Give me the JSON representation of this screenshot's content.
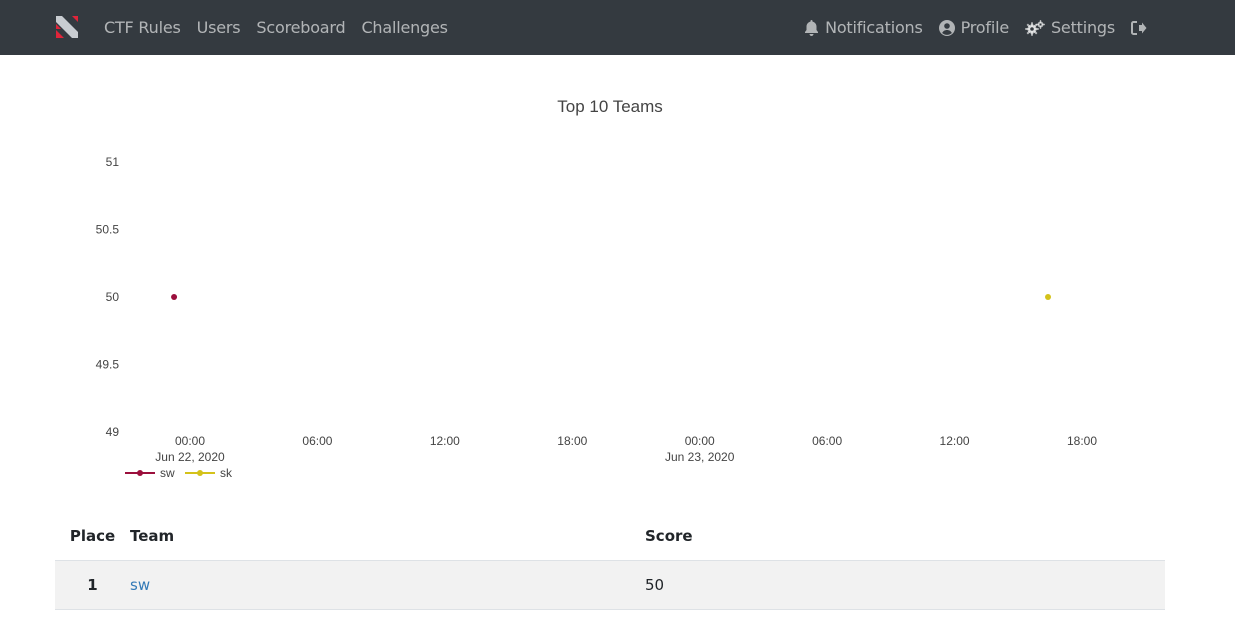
{
  "nav": {
    "left": [
      {
        "label": "CTF Rules"
      },
      {
        "label": "Users"
      },
      {
        "label": "Scoreboard"
      },
      {
        "label": "Challenges"
      }
    ],
    "right": {
      "notifications": "Notifications",
      "profile": "Profile",
      "settings": "Settings"
    }
  },
  "colors": {
    "navbar": "#343a40",
    "sw": "#9b0f3c",
    "sk": "#d4c21a",
    "link": "#337ab7"
  },
  "chart_data": {
    "type": "scatter",
    "title": "Top 10 Teams",
    "xlabel": "",
    "ylabel": "",
    "ylim": [
      49,
      51
    ],
    "yticks": [
      "51",
      "50.5",
      "50",
      "49.5",
      "49"
    ],
    "xticks": [
      {
        "time": "00:00",
        "date": "Jun 22, 2020"
      },
      {
        "time": "06:00",
        "date": ""
      },
      {
        "time": "12:00",
        "date": ""
      },
      {
        "time": "18:00",
        "date": ""
      },
      {
        "time": "00:00",
        "date": "Jun 23, 2020"
      },
      {
        "time": "06:00",
        "date": ""
      },
      {
        "time": "12:00",
        "date": ""
      },
      {
        "time": "18:00",
        "date": ""
      }
    ],
    "xlim_hours": [
      0,
      42
    ],
    "series": [
      {
        "name": "sw",
        "points": [
          {
            "x_hours": -0.75,
            "y": 50
          }
        ]
      },
      {
        "name": "sk",
        "points": [
          {
            "x_hours": 40.4,
            "y": 50
          }
        ]
      }
    ],
    "legend": "bottom-left"
  },
  "table": {
    "headers": {
      "place": "Place",
      "team": "Team",
      "score": "Score"
    },
    "rows": [
      {
        "place": "1",
        "team": "sw",
        "score": "50"
      }
    ]
  }
}
